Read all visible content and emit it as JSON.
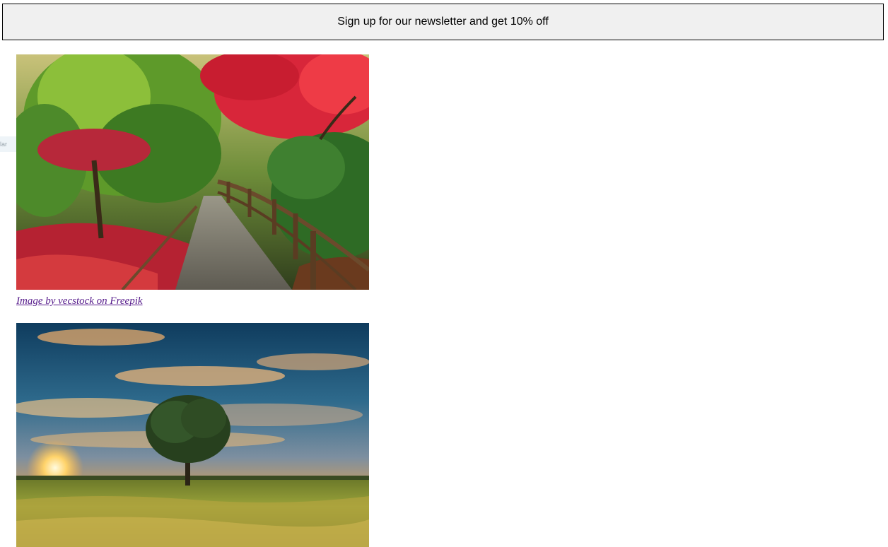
{
  "newsletter": {
    "text": "Sign up for our newsletter and get 10% off"
  },
  "side_tab": {
    "text": "lar"
  },
  "images": [
    {
      "credit": "Image by vecstock on Freepik"
    },
    {}
  ],
  "colors": {
    "link_visited": "#551a8b",
    "bar_background": "#f0f0f0"
  }
}
